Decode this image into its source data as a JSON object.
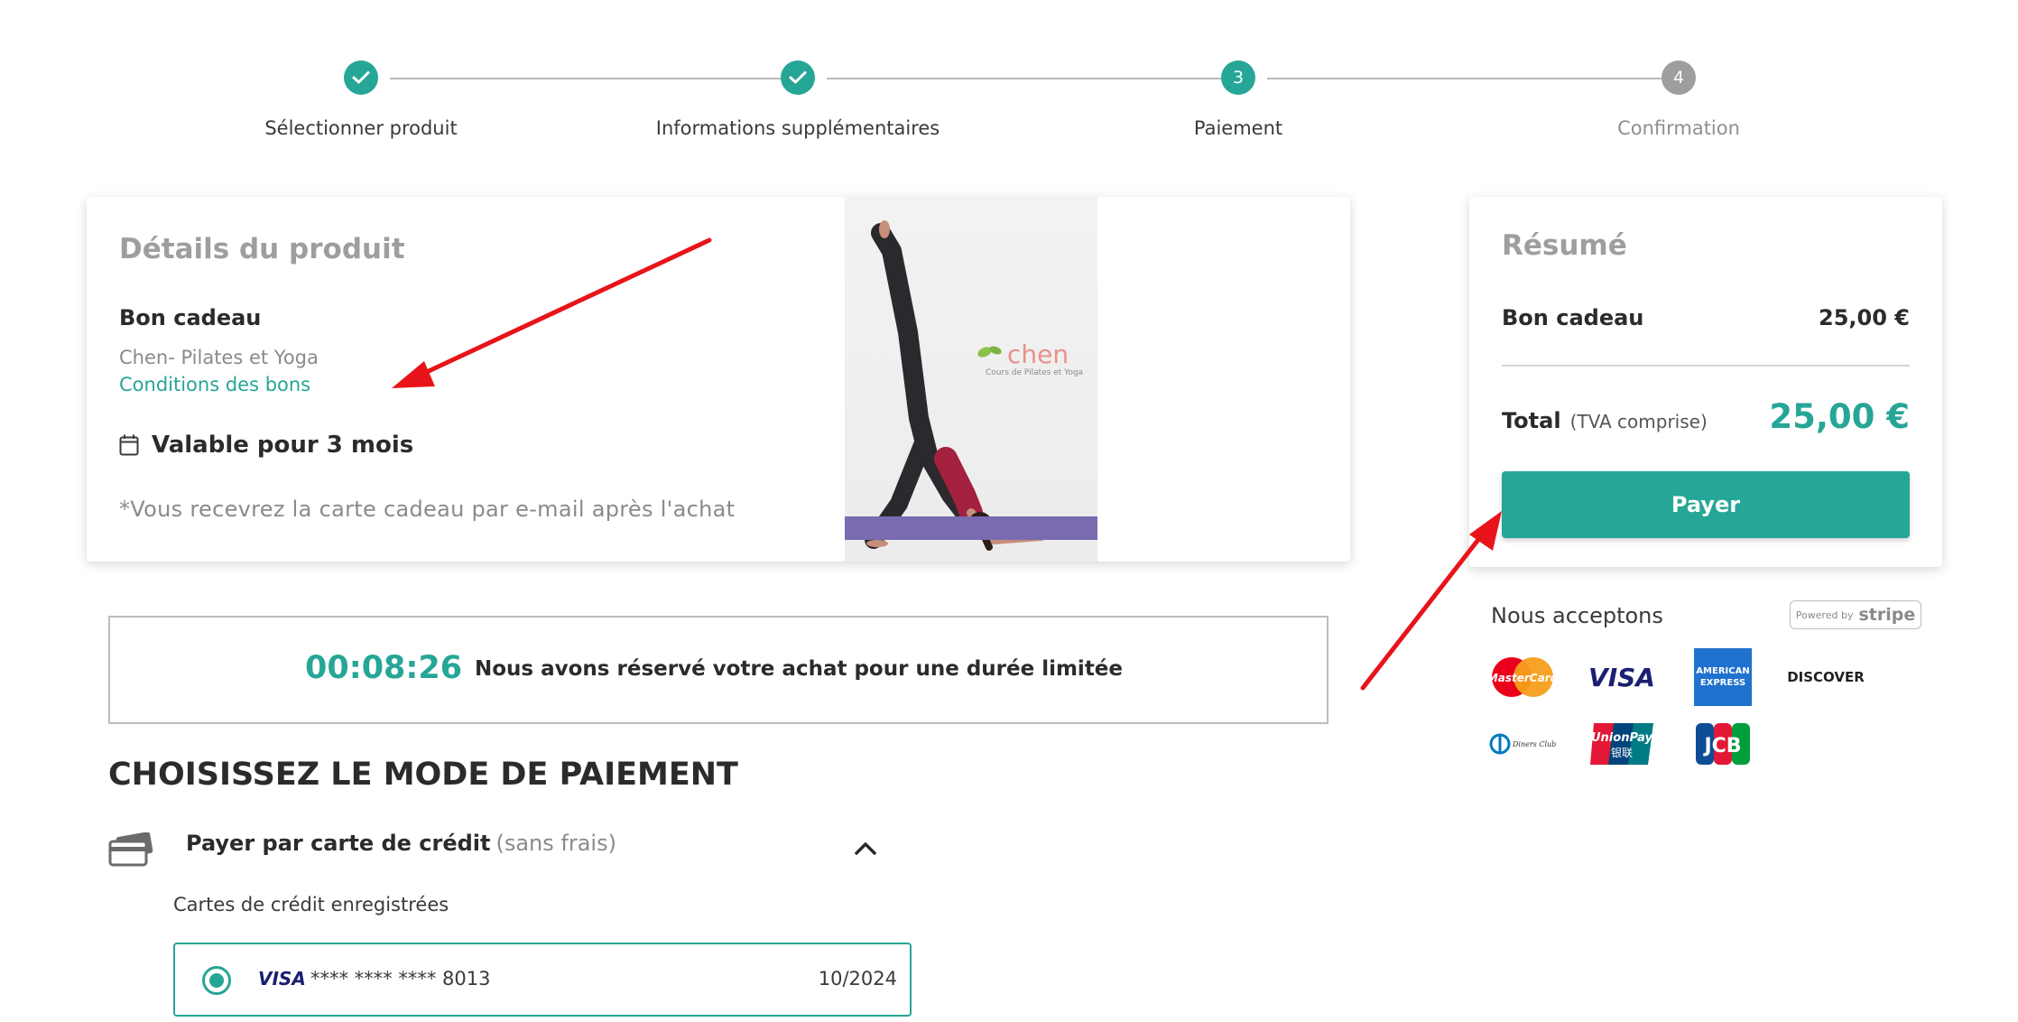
{
  "stepper": {
    "steps": [
      {
        "label": "Sélectionner produit",
        "state": "done"
      },
      {
        "label": "Informations supplémentaires",
        "state": "done"
      },
      {
        "label": "Paiement",
        "number": "3",
        "state": "active"
      },
      {
        "label": "Confirmation",
        "number": "4",
        "state": "todo"
      }
    ]
  },
  "product": {
    "title": "Détails du produit",
    "name": "Bon cadeau",
    "organization": "Chen- Pilates et Yoga",
    "conditions_link": "Conditions des bons",
    "validity": "Valable pour 3 mois",
    "note": "*Vous recevrez la carte cadeau par e-mail après l'achat",
    "image_brand": "chen",
    "image_brand_sub": "Cours de Pilates et Yoga"
  },
  "summary": {
    "title": "Résumé",
    "item_name": "Bon cadeau",
    "item_price": "25,00 €",
    "total_label": "Total",
    "total_tax_note": "(TVA comprise)",
    "total_amount": "25,00 €",
    "pay_button": "Payer"
  },
  "accept": {
    "label": "Nous acceptons",
    "powered_by": "Powered by",
    "stripe": "stripe",
    "cards": {
      "mastercard": "MasterCard",
      "visa": "VISA",
      "amex_top": "AMERICAN",
      "amex_bottom": "EXPRESS",
      "discover": "DISCOVER",
      "diners": "Diners Club International",
      "unionpay": "UnionPay",
      "unionpay_cn": "银联",
      "jcb": "JCB"
    }
  },
  "timer": {
    "value": "00:08:26",
    "text": "Nous avons réservé votre achat pour une durée limitée"
  },
  "payment": {
    "heading": "CHOISISSEZ LE MODE DE PAIEMENT",
    "method_label": "Payer par carte de crédit",
    "method_fee": "(sans frais)",
    "saved_label": "Cartes de crédit enregistrées",
    "saved_card": {
      "brand": "VISA",
      "number": "**** **** **** 8013",
      "expiry": "10/2024"
    }
  },
  "colors": {
    "accent": "#26a696",
    "annotation_arrow": "#e8141a",
    "muted": "#9e9e9e"
  }
}
